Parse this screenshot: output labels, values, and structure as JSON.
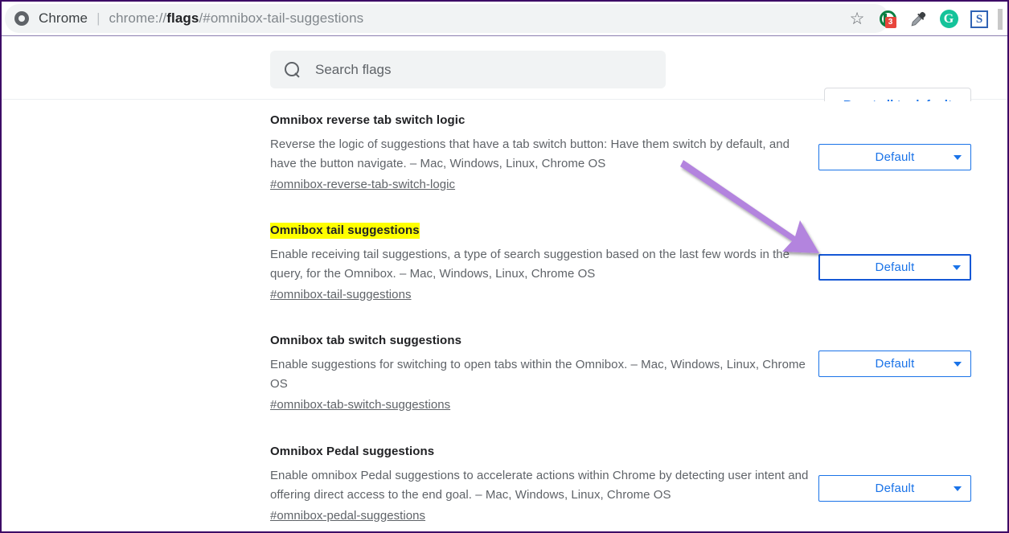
{
  "browser": {
    "brand": "Chrome",
    "separator": "|",
    "url_prefix": "chrome://",
    "url_bold": "flags",
    "url_suffix": "/#omnibox-tail-suggestions",
    "url_full": "chrome://flags/#omnibox-tail-suggestions",
    "icons": {
      "chrome_logo": "chrome-logo-icon",
      "bookmark_star": "star-icon",
      "star_glyph": "☆",
      "adblock": "adblock-extension-icon",
      "adblock_badge": "3",
      "eyedropper": "eyedropper-icon",
      "grammarly": "G",
      "grammarly_name": "grammarly-extension-icon",
      "sfile": "S",
      "sfile_name": "s-extension-icon"
    }
  },
  "search": {
    "placeholder": "Search flags",
    "value": "",
    "icon": "search-icon"
  },
  "header": {
    "reset_label": "Reset all to default"
  },
  "select_options": {
    "default": "Default",
    "arrow": "chevron-down-icon"
  },
  "flags": [
    {
      "title": "Omnibox reverse tab switch logic",
      "highlighted": false,
      "description": "Reverse the logic of suggestions that have a tab switch button: Have them switch by default, and have the button navigate. – Mac, Windows, Linux, Chrome OS",
      "hash": "#omnibox-reverse-tab-switch-logic",
      "select_value": "Default",
      "focused": false
    },
    {
      "title": "Omnibox tail suggestions",
      "highlighted": true,
      "description": "Enable receiving tail suggestions, a type of search suggestion based on the last few words in the query, for the Omnibox. – Mac, Windows, Linux, Chrome OS",
      "hash": "#omnibox-tail-suggestions",
      "select_value": "Default",
      "focused": true
    },
    {
      "title": "Omnibox tab switch suggestions",
      "highlighted": false,
      "description": "Enable suggestions for switching to open tabs within the Omnibox. – Mac, Windows, Linux, Chrome OS",
      "hash": "#omnibox-tab-switch-suggestions",
      "select_value": "Default",
      "focused": false
    },
    {
      "title": "Omnibox Pedal suggestions",
      "highlighted": false,
      "description": "Enable omnibox Pedal suggestions to accelerate actions within Chrome by detecting user intent and offering direct access to the end goal. – Mac, Windows, Linux, Chrome OS",
      "hash": "#omnibox-pedal-suggestions",
      "select_value": "Default",
      "focused": false
    }
  ],
  "annotation": {
    "type": "arrow",
    "color": "#b384de",
    "points_to": "flag-select-omnibox-tail-suggestions"
  },
  "colors": {
    "frame_border": "#3d0a66",
    "accent_blue": "#1a73e8",
    "highlight_yellow": "#ffff00",
    "text_primary": "#202124",
    "text_secondary": "#5f6368",
    "field_bg": "#f1f3f4"
  }
}
